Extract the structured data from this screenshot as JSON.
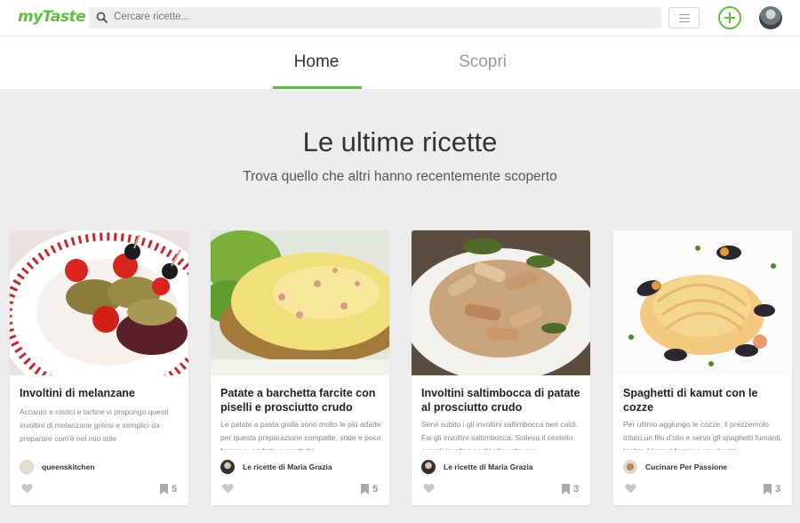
{
  "header": {
    "logo": "myTaste",
    "search_placeholder": "Cercare ricette..."
  },
  "tabs": [
    {
      "label": "Home",
      "active": true
    },
    {
      "label": "Scopri",
      "active": false
    }
  ],
  "hero": {
    "title": "Le ultime ricette",
    "subtitle": "Trova quello che altri hanno recentemente scoperto"
  },
  "colors": {
    "brand_green": "#5cc03a",
    "background": "#ededed"
  },
  "recipes": [
    {
      "title": "Involtini di melanzane",
      "description": "Accanto e rustici e tartine vi propongo questi involtini di melanzane golosi e semplici da preparare com'è nel mio stile",
      "author": "queenskitchen",
      "bookmarks": "5"
    },
    {
      "title": "Patate a barchetta farcite con piselli e prosciutto crudo",
      "description": "Le patate a pasta gialla sono molto le più adatte per questa preparazione compatte, sode e poco farinose, perfette soprattutto",
      "author": "Le ricette di Maria Grazia",
      "bookmarks": "5"
    },
    {
      "title": "Involtini saltimbocca di patate al prosciutto crudo",
      "description": "Servi subito i gli involtini saltimbocca ben caldi. Fai gli involtini saltimbocca. Solleva il cestello con gli involtini pochi alla volta per",
      "author": "Le ricette di Maria Grazia",
      "bookmarks": "3"
    },
    {
      "title": "Spaghetti di kamut con le cozze",
      "description": "Per ultimo aggiungo le cozze, il prezzemolo tritato,un filo d'olio e servo gli spaghetti fumanti. Inoltre il kamut fornisce un elevato",
      "author": "Cucinare Per Passione",
      "bookmarks": "3"
    }
  ]
}
